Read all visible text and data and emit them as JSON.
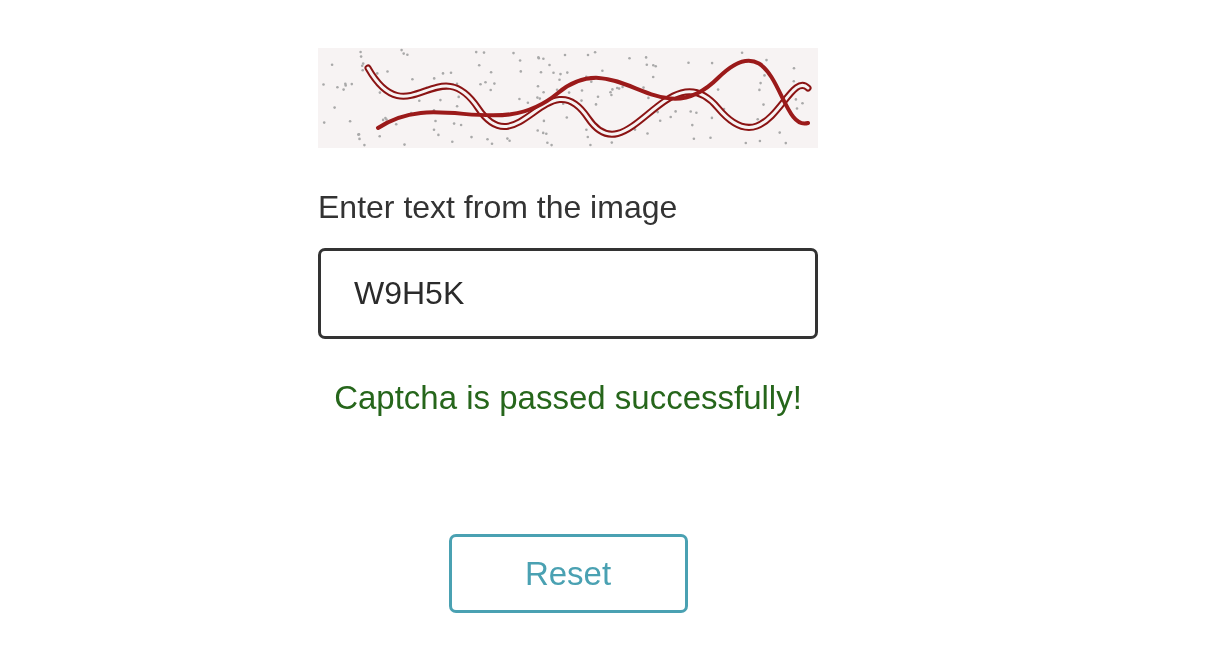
{
  "captcha": {
    "label": "Enter text from the image",
    "input": {
      "value": "W9H5K"
    },
    "message": {
      "text": "Captcha is passed successfully!",
      "passed": true
    }
  },
  "buttons": [
    "Reset"
  ]
}
